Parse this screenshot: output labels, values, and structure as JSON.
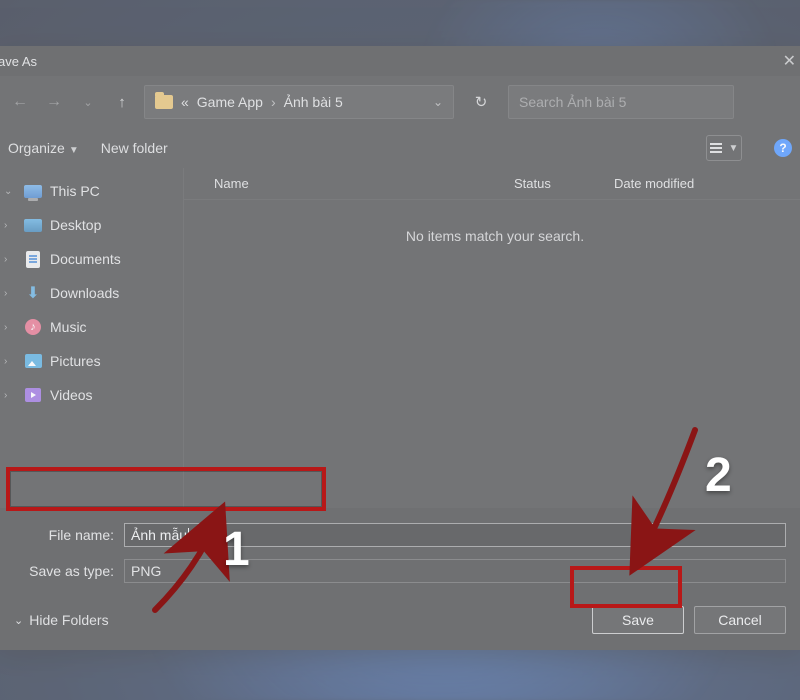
{
  "titlebar": {
    "title": "ave As"
  },
  "breadcrumb": {
    "prefix": "«",
    "seg1": "Game App",
    "seg2": "Ảnh bài 5"
  },
  "search": {
    "placeholder": "Search Ảnh bài 5"
  },
  "toolbar": {
    "organize": "Organize",
    "newfolder": "New folder"
  },
  "columns": {
    "name": "Name",
    "status": "Status",
    "date": "Date modified"
  },
  "listing": {
    "empty": "No items match your search."
  },
  "sidebar": {
    "root": "This PC",
    "items": [
      {
        "label": "Desktop"
      },
      {
        "label": "Documents"
      },
      {
        "label": "Downloads"
      },
      {
        "label": "Music"
      },
      {
        "label": "Pictures"
      },
      {
        "label": "Videos"
      }
    ]
  },
  "form": {
    "filename_label": "File name:",
    "filename_value": "Ảnh mẫu",
    "type_label": "Save as type:",
    "type_value": "PNG"
  },
  "footer": {
    "hide": "Hide Folders",
    "save": "Save",
    "cancel": "Cancel"
  },
  "annotation": {
    "step1": "1",
    "step2": "2"
  }
}
